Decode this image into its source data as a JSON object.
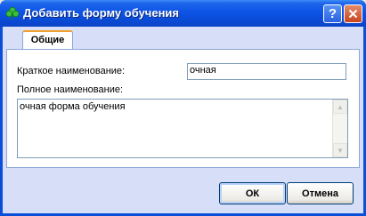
{
  "window": {
    "title": "Добавить форму обучения",
    "icon": "green-clover-icon",
    "help_glyph": "?",
    "close_glyph": "✕"
  },
  "tabs": [
    {
      "label": "Общие",
      "active": true
    }
  ],
  "form": {
    "short_name_label": "Краткое наименование:",
    "short_name_value": "очная",
    "full_name_label": "Полное наименование:",
    "full_name_value": "очная форма обучения"
  },
  "buttons": {
    "ok_label": "ОК",
    "cancel_label": "Отмена"
  },
  "colors": {
    "titlebar": "#0a4fd8",
    "client_bg": "#d6dff7",
    "tab_accent": "#f0a030"
  }
}
